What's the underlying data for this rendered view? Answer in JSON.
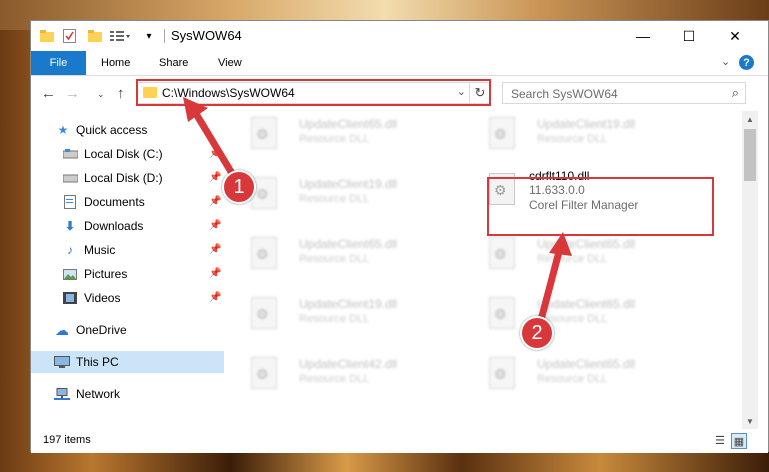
{
  "window": {
    "title": "SysWOW64",
    "controls": {
      "minimize": "—",
      "maximize": "☐",
      "close": "✕"
    }
  },
  "ribbon": {
    "tabs": [
      "File",
      "Home",
      "Share",
      "View"
    ],
    "help": "?"
  },
  "nav": {
    "address": "C:\\Windows\\SysWOW64",
    "search_placeholder": "Search SysWOW64"
  },
  "sidebar": {
    "items": [
      {
        "label": "Quick access",
        "icon": "star-icon"
      },
      {
        "label": "Local Disk (C:)",
        "icon": "drive-icon"
      },
      {
        "label": "Local Disk (D:)",
        "icon": "drive-icon"
      },
      {
        "label": "Documents",
        "icon": "documents-icon"
      },
      {
        "label": "Downloads",
        "icon": "download-icon"
      },
      {
        "label": "Music",
        "icon": "music-icon"
      },
      {
        "label": "Pictures",
        "icon": "pictures-icon"
      },
      {
        "label": "Videos",
        "icon": "videos-icon"
      },
      {
        "label": "OneDrive",
        "icon": "cloud-icon"
      },
      {
        "label": "This PC",
        "icon": "computer-icon"
      },
      {
        "label": "Network",
        "icon": "network-icon"
      }
    ]
  },
  "files": {
    "left": [
      {
        "name": "UpdateClient65.dll",
        "desc": "Resource DLL"
      },
      {
        "name": "UpdateClient19.dll",
        "desc": "Resource DLL"
      },
      {
        "name": "UpdateClient65.dll",
        "desc": "Resource DLL"
      },
      {
        "name": "UpdateClient19.dll",
        "desc": "Resource DLL"
      },
      {
        "name": "UpdateClient42.dll",
        "desc": "Resource DLL"
      }
    ],
    "right": [
      {
        "name": "UpdateClient19.dll",
        "desc": "Resource DLL"
      },
      {
        "name": "UpdateClient65.dll",
        "desc": "Resource DLL"
      },
      {
        "name": "UpdateClient65.dll",
        "desc": "Resource DLL"
      },
      {
        "name": "UpdateClient65.dll",
        "desc": "Resource DLL"
      }
    ],
    "highlighted": {
      "name": "cdrflt110.dll",
      "version": "11.633.0.0",
      "desc": "Corel Filter Manager"
    }
  },
  "status": {
    "items": "197 items"
  },
  "callouts": [
    "1",
    "2"
  ],
  "colors": {
    "accent": "#1979ca",
    "highlight": "#d9383a",
    "selected": "#cce4f7"
  }
}
